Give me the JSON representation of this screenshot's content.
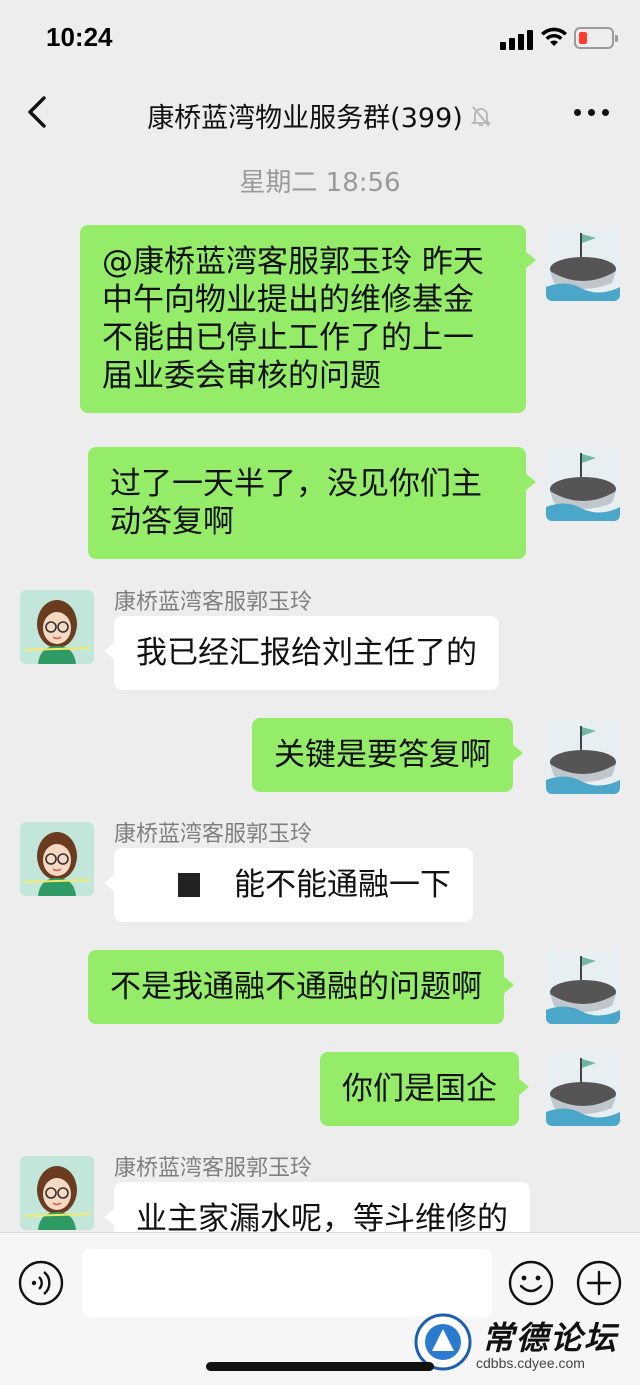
{
  "status_bar": {
    "time": "10:24"
  },
  "header": {
    "title": "康桥蓝湾物业服务群(399)",
    "back_icon": "chevron-left-icon",
    "mute_icon": "bell-slash-icon",
    "more_icon": "ellipsis-icon"
  },
  "chat": {
    "timestamp": "星期二 18:56",
    "messages": [
      {
        "side": "self",
        "text": "@康桥蓝湾客服郭玉玲 昨天中午向物业提出的维修基金不能由已停止工作了的上一届业委会审核的问题"
      },
      {
        "side": "self",
        "text": "过了一天半了，没见你们主动答复啊"
      },
      {
        "side": "other",
        "sender": "康桥蓝湾客服郭玉玲",
        "text": "我已经汇报给刘主任了的"
      },
      {
        "side": "self",
        "text": "关键是要答复啊"
      },
      {
        "side": "other",
        "sender": "康桥蓝湾客服郭玉玲",
        "text": "能不能通融一下"
      },
      {
        "side": "self",
        "text": "不是我通融不通融的问题啊"
      },
      {
        "side": "self",
        "text": "你们是国企"
      },
      {
        "side": "other",
        "sender": "康桥蓝湾客服郭玉玲",
        "text": "业主家漏水呢，等斗维修的"
      }
    ]
  },
  "input_bar": {
    "voice_icon": "voice-icon",
    "emoji_icon": "emoji-icon",
    "plus_icon": "plus-icon",
    "value": ""
  },
  "watermark": {
    "title": "常德论坛",
    "url": "cdbbs.cdyee.com"
  },
  "colors": {
    "background": "#ededed",
    "self_bubble": "#95ec69",
    "other_bubble": "#ffffff",
    "battery_low": "#ff3b30"
  }
}
